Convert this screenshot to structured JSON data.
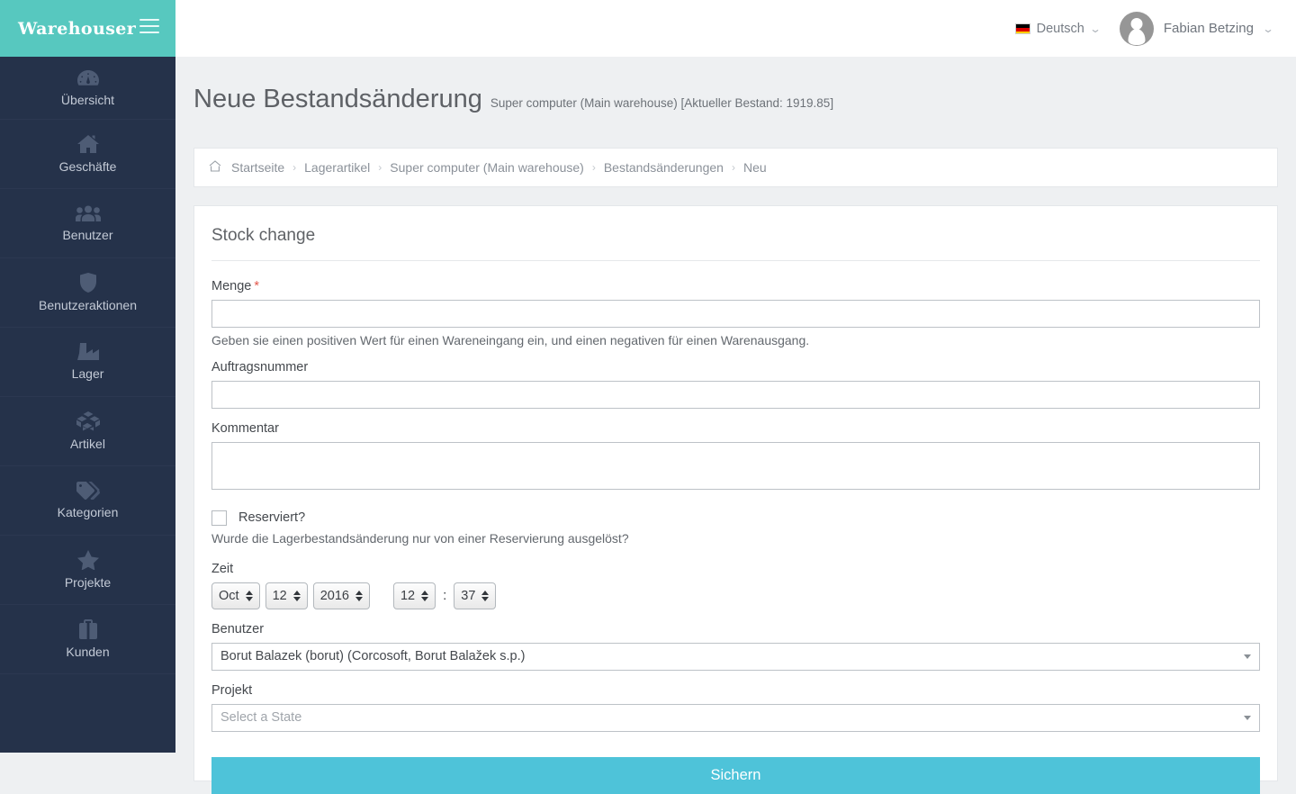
{
  "brand": {
    "title": "Warehouser",
    "menu_icon": "hamburger-icon"
  },
  "header": {
    "language": {
      "label": "Deutsch",
      "flag": "german-flag-icon",
      "caret": "chevron-down-icon"
    },
    "user": {
      "name": "Fabian Betzing",
      "avatar": "user-avatar-icon",
      "caret": "chevron-down-icon"
    }
  },
  "sidebar": {
    "items": [
      {
        "label": "Übersicht",
        "icon": "dashboard-icon"
      },
      {
        "label": "Geschäfte",
        "icon": "home-icon"
      },
      {
        "label": "Benutzer",
        "icon": "users-icon"
      },
      {
        "label": "Benutzeraktionen",
        "icon": "shield-icon"
      },
      {
        "label": "Lager",
        "icon": "factory-icon"
      },
      {
        "label": "Artikel",
        "icon": "boxes-icon"
      },
      {
        "label": "Kategorien",
        "icon": "tag-icon"
      },
      {
        "label": "Projekte",
        "icon": "star-icon"
      },
      {
        "label": "Kunden",
        "icon": "briefcase-icon"
      }
    ]
  },
  "page": {
    "title": "Neue Bestandsänderung",
    "subtitle": "Super computer (Main warehouse) [Aktueller Bestand: 1919.85]"
  },
  "breadcrumb": {
    "home_icon": "home-icon",
    "separator": "›",
    "items": [
      "Startseite",
      "Lagerartikel",
      "Super computer (Main warehouse)",
      "Bestandsänderungen",
      "Neu"
    ]
  },
  "form": {
    "title": "Stock change",
    "quantity": {
      "label": "Menge",
      "required_marker": "*",
      "value": "",
      "help": "Geben sie einen positiven Wert für einen Wareneingang ein, und einen negativen für einen Warenausgang."
    },
    "order_number": {
      "label": "Auftragsnummer",
      "value": ""
    },
    "comment": {
      "label": "Kommentar",
      "value": ""
    },
    "reserved": {
      "label": "Reserviert?",
      "checked": false,
      "help": "Wurde die Lagerbestandsänderung nur von einer Reservierung ausgelöst?"
    },
    "time": {
      "label": "Zeit",
      "month": "Oct",
      "day": "12",
      "year": "2016",
      "hour": "12",
      "minute": "37",
      "separator": ":"
    },
    "user": {
      "label": "Benutzer",
      "value": "Borut Balazek (borut) (Corcosoft, Borut Balažek s.p.)"
    },
    "project": {
      "label": "Projekt",
      "value": "",
      "placeholder": "Select a State"
    },
    "submit_label": "Sichern"
  },
  "colors": {
    "brand_teal": "#57c8bf",
    "sidebar_navy": "#25324a",
    "submit_cyan": "#4ec3d9",
    "required_red": "#e2574c",
    "page_background": "#eef0f2"
  }
}
